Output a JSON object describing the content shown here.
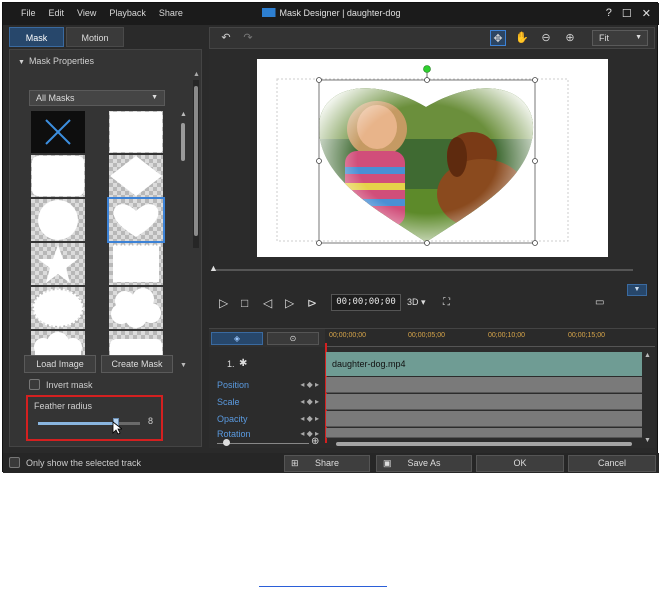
{
  "window": {
    "title": "Mask Designer  |  daughter-dog",
    "menu": [
      "File",
      "Edit",
      "View",
      "Playback",
      "Share"
    ],
    "controls": [
      "?",
      "☐",
      "✕"
    ]
  },
  "left_panel": {
    "tabs": [
      "Mask",
      "Motion"
    ],
    "active_tab": "Mask",
    "section_title": "Mask Properties",
    "filter": "All Masks",
    "mask_shapes": [
      "none",
      "rectangle",
      "rounded-rectangle",
      "diamond",
      "circle",
      "heart",
      "star",
      "stamp",
      "burst",
      "cloud",
      "cloud-bottom",
      "rounded-rectangle-bottom"
    ],
    "selected_shape": "heart",
    "load_image_label": "Load Image",
    "create_mask_label": "Create Mask",
    "invert_mask_label": "Invert mask",
    "invert_checked": false,
    "feather": {
      "label": "Feather radius",
      "value": "8",
      "fraction": 0.76
    }
  },
  "toolbar": {
    "zoom_label": "Fit"
  },
  "preview": {
    "image_description_shown": false
  },
  "playback": {
    "timecode": "00;00;00;00",
    "mode_label": "3D"
  },
  "timeline": {
    "ruler_ticks": [
      "00;00;00;00",
      "00;00;05;00",
      "00;00;10;00",
      "00;00;15;00"
    ],
    "track_number": "1.",
    "clip_name": "daughter-dog.mp4",
    "properties": [
      "Position",
      "Scale",
      "Opacity",
      "Rotation"
    ]
  },
  "footer": {
    "only_show_label": "Only show the selected track",
    "share_label": "Share",
    "save_as_label": "Save As",
    "ok_label": "OK",
    "cancel_label": "Cancel"
  },
  "colors": {
    "accent": "#3c82d6",
    "highlight_box": "#d42020",
    "clip": "#6f9c94",
    "property_text": "#5a9ae0"
  }
}
